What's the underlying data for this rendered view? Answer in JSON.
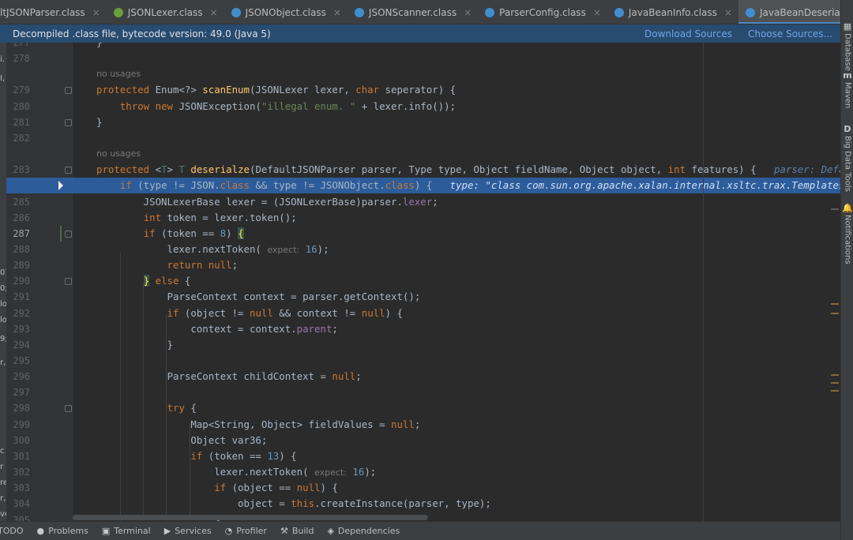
{
  "tabs": [
    {
      "label": "ltJSONParser.class",
      "icon": "class-icon",
      "color": "#4a9e5c"
    },
    {
      "label": "JSONLexer.class",
      "icon": "interface-icon",
      "color": "#6a9e3c"
    },
    {
      "label": "JSONObject.class",
      "icon": "class-icon",
      "color": "#3f8fcf"
    },
    {
      "label": "JSONScanner.class",
      "icon": "class-icon",
      "color": "#3f8fcf"
    },
    {
      "label": "ParserConfig.class",
      "icon": "class-icon",
      "color": "#3f8fcf"
    },
    {
      "label": "JavaBeanInfo.class",
      "icon": "class-icon",
      "color": "#3f8fcf"
    },
    {
      "label": "JavaBeanDeserializer.class",
      "icon": "class-icon",
      "color": "#3f8fcf"
    }
  ],
  "banner": {
    "message": "Decompiled .class file, bytecode version: 49.0 (Java 5)",
    "download_sources": "Download Sources",
    "choose_sources": "Choose Sources..."
  },
  "left_strip_chars": [
    "i.",
    "I,",
    "0)",
    "0;",
    "lo",
    "lo",
    "9;",
    "r,",
    "c",
    "r",
    "re",
    "r,",
    "ve",
    "3;",
    "ODO"
  ],
  "code_lines": [
    {
      "no": "277",
      "html": "}"
    },
    {
      "no": "278",
      "html": ""
    },
    {
      "no": "",
      "hint": "no usages"
    },
    {
      "no": "279",
      "html": "<span class=\"kw\">protected</span> Enum&lt;?&gt; <span class=\"fn\">scanEnum</span>(JSONLexer lexer, <span class=\"kw\">char</span> seperator) {"
    },
    {
      "no": "280",
      "html": "    <span class=\"kw\">throw new</span> JSONException(<span class=\"str\">\"illegal enum. \"</span> + lexer.info());"
    },
    {
      "no": "281",
      "html": "}"
    },
    {
      "no": "282",
      "html": ""
    },
    {
      "no": "",
      "hint": "no usages"
    },
    {
      "no": "283",
      "html": "<span class=\"kw\">protected</span> &lt;<span class=\"gen\">T</span>&gt; <span class=\"gen\">T</span> <span class=\"fn\">deserialze</span>(DefaultJSONParser parser, Type type, Object fieldName, Object object, <span class=\"kw\">int</span> features) {   <span class=\"dbg\">parser: DefaultJSONParser@...</span>"
    },
    {
      "no": "284",
      "sel": true,
      "html": "    <span class=\"kw\">if</span> (type != JSON.<span class=\"kw\">class</span> &amp;&amp; type != JSONObject.<span class=\"kw\">class</span>) {   <span class=\"dbg sel\">type: \"class com.sun.org.apache.xalan.internal.xsltc.trax.TemplatesImpl\"</span>"
    },
    {
      "no": "285",
      "html": "        JSONLexerBase lexer = (JSONLexerBase)parser.<span class=\"fld\">lexer</span>;"
    },
    {
      "no": "286",
      "html": "        <span class=\"kw\">int</span> token = lexer.token();"
    },
    {
      "no": "287",
      "html": "        <span class=\"kw\">if</span> (token == <span class=\"num\">8</span>) <span class=\"br\">{</span>"
    },
    {
      "no": "288",
      "html": "            lexer.nextToken( <span class=\"iht\">expect:</span> <span class=\"num\">16</span>);"
    },
    {
      "no": "289",
      "html": "            <span class=\"kw\">return null</span>;"
    },
    {
      "no": "290",
      "html": "        <span class=\"br\">}</span> <span class=\"kw\">else</span> {"
    },
    {
      "no": "291",
      "html": "            ParseContext context = parser.getContext();"
    },
    {
      "no": "292",
      "html": "            <span class=\"kw\">if</span> (object != <span class=\"kw\">null</span> &amp;&amp; context != <span class=\"kw\">null</span>) {"
    },
    {
      "no": "293",
      "html": "                context = context.<span class=\"fld\">parent</span>;"
    },
    {
      "no": "294",
      "html": "            }"
    },
    {
      "no": "295",
      "html": ""
    },
    {
      "no": "296",
      "html": "            ParseContext childContext = <span class=\"kw\">null</span>;"
    },
    {
      "no": "297",
      "html": ""
    },
    {
      "no": "298",
      "html": "            <span class=\"kw\">try</span> {"
    },
    {
      "no": "299",
      "html": "                Map&lt;String, Object&gt; fieldValues = <span class=\"kw\">null</span>;"
    },
    {
      "no": "300",
      "html": "                Object var36;"
    },
    {
      "no": "301",
      "html": "                <span class=\"kw\">if</span> (token == <span class=\"num\">13</span>) {"
    },
    {
      "no": "302",
      "html": "                    lexer.nextToken( <span class=\"iht\">expect:</span> <span class=\"num\">16</span>);"
    },
    {
      "no": "303",
      "html": "                    <span class=\"kw\">if</span> (object == <span class=\"kw\">null</span>) {"
    },
    {
      "no": "304",
      "html": "                        object = <span class=\"kw\">this</span>.createInstance(parser, type);"
    },
    {
      "no": "305",
      "html": "                    }"
    }
  ],
  "right_tools": [
    {
      "icon": "database-icon",
      "label": "Database"
    },
    {
      "icon": "maven-icon",
      "label": "Maven"
    },
    {
      "icon": "big-data-tools-icon",
      "label": "Big Data Tools"
    },
    {
      "icon": "notifications-icon",
      "label": "Notifications"
    }
  ],
  "bottom_tools": [
    {
      "name": "todo",
      "label": "TODO",
      "icon": ""
    },
    {
      "name": "problems",
      "label": "Problems",
      "icon": "●"
    },
    {
      "name": "terminal",
      "label": "Terminal",
      "icon": "▣"
    },
    {
      "name": "services",
      "label": "Services",
      "icon": "▶"
    },
    {
      "name": "profiler",
      "label": "Profiler",
      "icon": "◔"
    },
    {
      "name": "build",
      "label": "Build",
      "icon": "⚒"
    },
    {
      "name": "dependencies",
      "label": "Dependencies",
      "icon": "◈"
    }
  ],
  "colors": {
    "selection": "#2d5c9a",
    "banner": "#284b70",
    "keyword": "#cc7832",
    "method": "#ffc66d",
    "string": "#6a8759",
    "number": "#6897bb"
  }
}
